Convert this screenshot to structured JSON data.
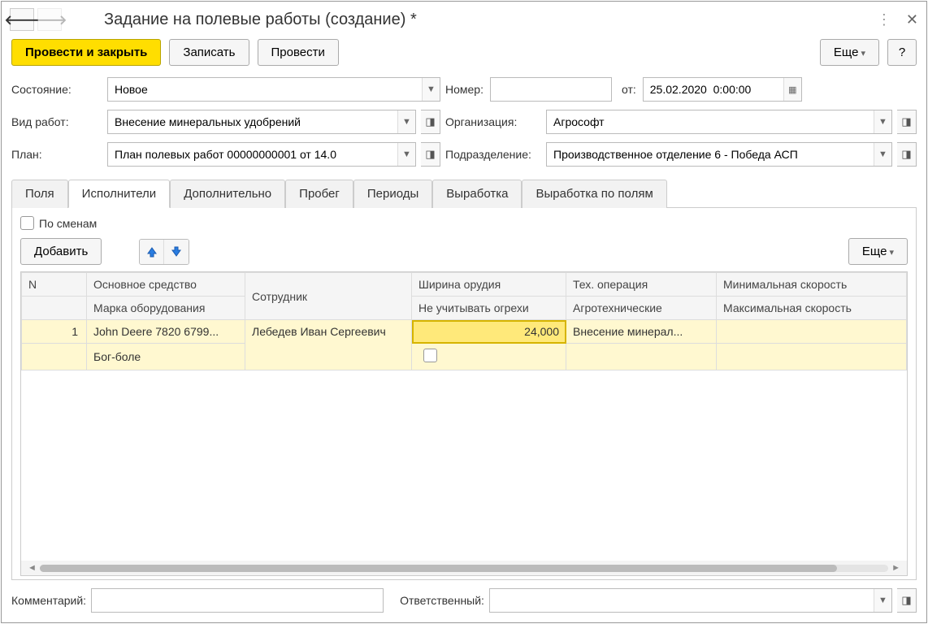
{
  "window": {
    "title": "Задание на полевые работы (создание) *"
  },
  "commands": {
    "post_close": "Провести и закрыть",
    "save": "Записать",
    "post": "Провести",
    "more": "Еще",
    "help": "?"
  },
  "labels": {
    "state": "Состояние:",
    "number": "Номер:",
    "from": "от:",
    "work_type": "Вид работ:",
    "organization": "Организация:",
    "plan": "План:",
    "department": "Подразделение:",
    "comment": "Комментарий:",
    "responsible": "Ответственный:",
    "by_shifts": "По сменам",
    "add": "Добавить",
    "more_table": "Еще"
  },
  "fields": {
    "state": "Новое",
    "number": "",
    "date": "25.02.2020  0:00:00",
    "work_type": "Внесение минеральных удобрений",
    "organization": "Агрософт",
    "plan": "План полевых работ 00000000001 от 14.0",
    "department": "Производственное отделение 6 - Победа АСП",
    "comment": "",
    "responsible": ""
  },
  "tabs": [
    "Поля",
    "Исполнители",
    "Дополнительно",
    "Пробег",
    "Периоды",
    "Выработка",
    "Выработка по полям"
  ],
  "active_tab": 1,
  "table": {
    "headers_row1": [
      "N",
      "Основное средство",
      "Сотрудник",
      "Ширина орудия",
      "Тех. операция",
      "Минимальная скорость"
    ],
    "headers_row2": [
      "",
      "Марка оборудования",
      "",
      "Не учитывать огрехи",
      "Агротехнические",
      "Максимальная скорость"
    ],
    "rows": [
      {
        "n": "1",
        "asset": "John Deere 7820 6799...",
        "equipment": "Бог-боле",
        "employee": "Лебедев Иван Сергеевич",
        "width": "24,000",
        "ignore": false,
        "operation": "Внесение минерал...",
        "agro": "",
        "min_speed": "",
        "max_speed": ""
      }
    ]
  }
}
